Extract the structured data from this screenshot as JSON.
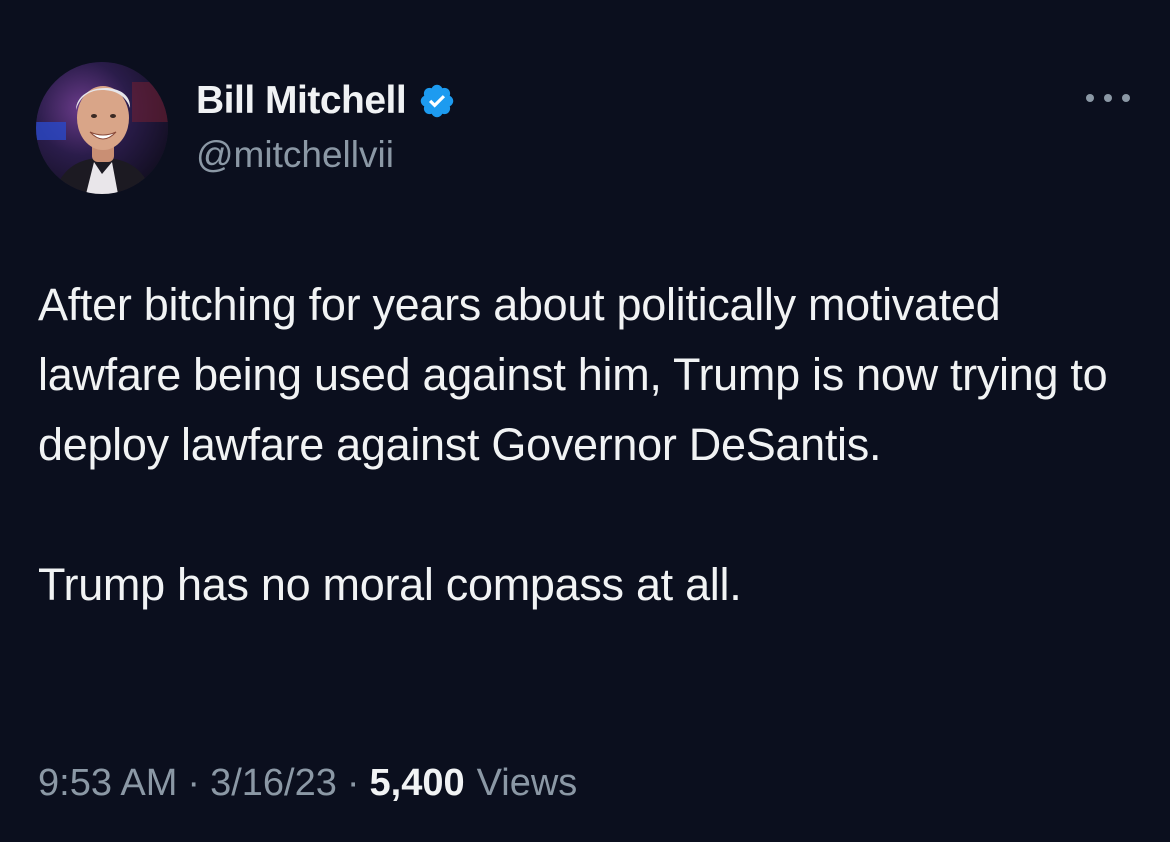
{
  "author": {
    "display_name": "Bill Mitchell",
    "handle": "@mitchellvii",
    "verified": true,
    "verified_color": "#1d9bf0"
  },
  "tweet": {
    "paragraphs": [
      "After bitching for years about politically motivated lawfare being used against him, Trump is now trying to deploy lawfare against Governor DeSantis.",
      "Trump has no moral compass at all."
    ]
  },
  "meta": {
    "time": "9:53 AM",
    "separator": "·",
    "date": "3/16/23",
    "views_count": "5,400",
    "views_label": "Views"
  },
  "colors": {
    "background": "#0b0f1e",
    "text": "#f1f3f4",
    "secondary_text": "#8b98a5"
  }
}
